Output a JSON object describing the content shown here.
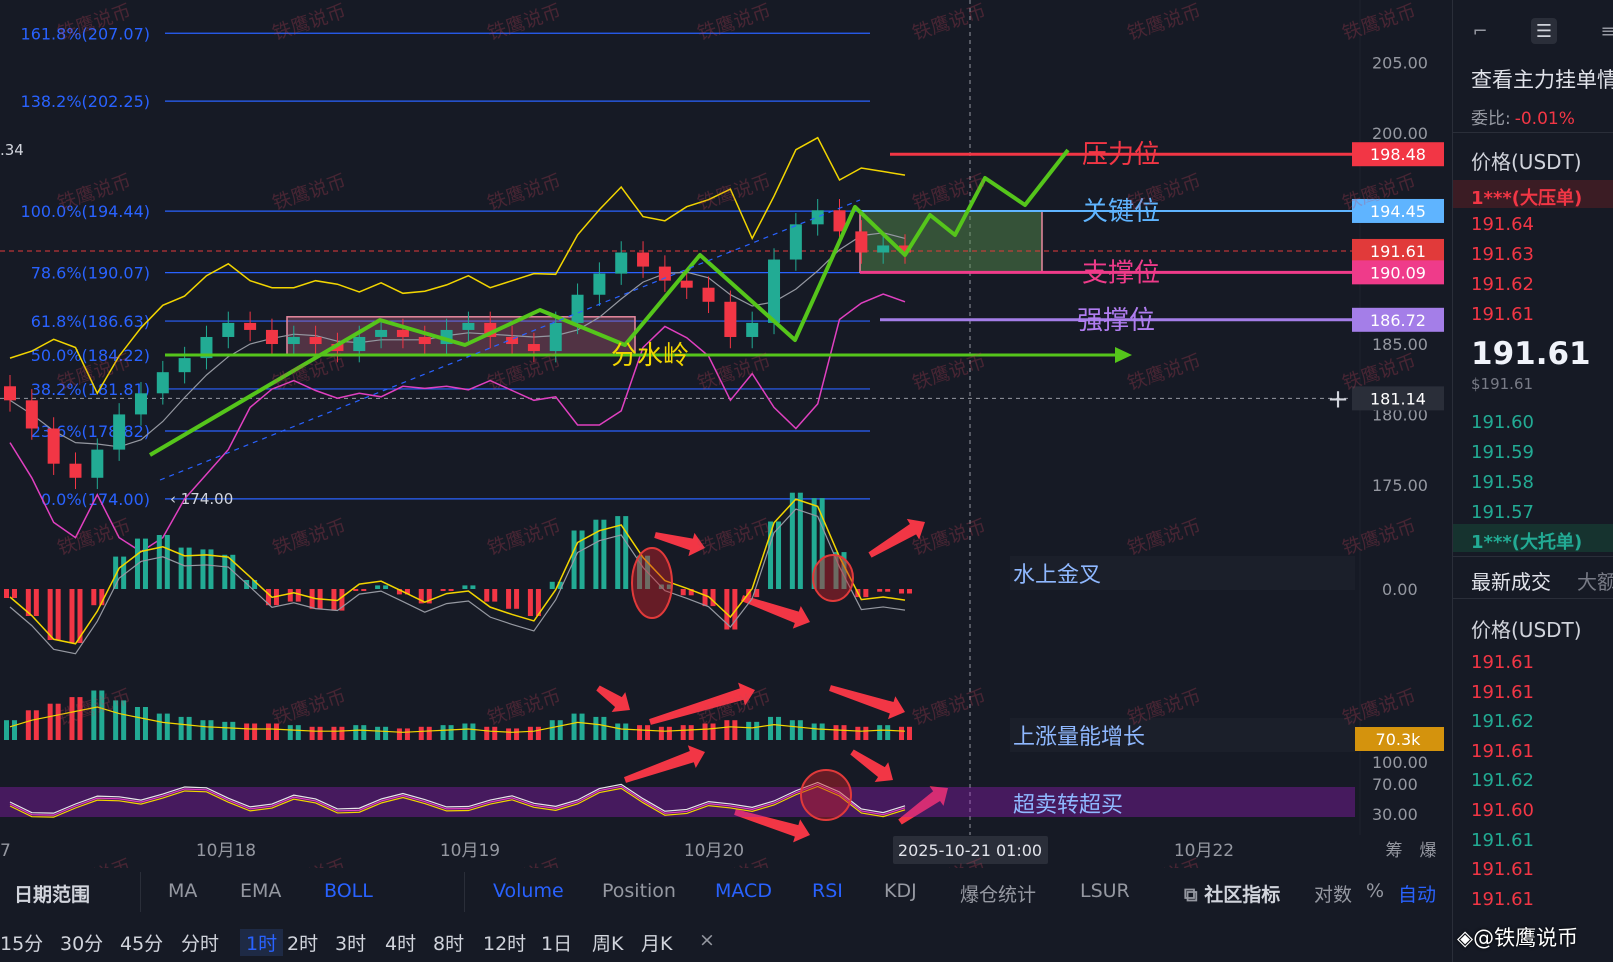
{
  "chart_data": {
    "type": "candlestick",
    "symbol_quote": "USDT",
    "y_ticks": [
      "205.00",
      "200.00",
      "185.00",
      "180.00",
      "175.00"
    ],
    "x_ticks": [
      "10月18",
      "10月19",
      "10月20",
      "10月22"
    ],
    "x_tick_partial_left": "7",
    "crosshair_time": "2025-10-21 01:00",
    "fib_levels": [
      {
        "label": "161.8%(207.07)",
        "value": 207.07
      },
      {
        "label": "138.2%(202.25)",
        "value": 202.25
      },
      {
        "label": "100.0%(194.44)",
        "value": 194.44
      },
      {
        "label": "78.6%(190.07)",
        "value": 190.07
      },
      {
        "label": "61.8%(186.63)",
        "value": 186.63
      },
      {
        "label": "50.0%(184.22)",
        "value": 184.22
      },
      {
        "label": "38.2%(181.81)",
        "value": 181.81
      },
      {
        "label": "23.6%(178.82)",
        "value": 178.82
      },
      {
        "label": "0.0%(174.00)",
        "value": 174.0
      }
    ],
    "low_marker": "174.00",
    "partial_left_label": ".34",
    "price_tags": [
      {
        "value": "198.48",
        "bg": "#f23645",
        "price": 198.48
      },
      {
        "value": "194.45",
        "bg": "#5fb4ff",
        "price": 194.45
      },
      {
        "value": "191.61",
        "bg": "#e13a3a",
        "price": 191.61
      },
      {
        "value": "190.09",
        "bg": "#ef3b8a",
        "price": 190.09
      },
      {
        "value": "186.72",
        "bg": "#a47ee8",
        "price": 186.72
      },
      {
        "value": "181.14",
        "bg": "#2a2e39",
        "price": 181.14
      }
    ],
    "annotations": [
      {
        "text": "压力位",
        "color": "#f23645",
        "price": 198.48
      },
      {
        "text": "关键位",
        "color": "#5fb4ff",
        "price": 194.45
      },
      {
        "text": "支撑位",
        "color": "#ef3b8a",
        "price": 190.09
      },
      {
        "text": "强撑位",
        "color": "#b07df0",
        "price": 186.72
      },
      {
        "text": "分水岭",
        "color": "#f2d500",
        "price": 184.22
      }
    ],
    "macd_zero_label": "0.00",
    "macd_annotation": "水上金叉",
    "volume_tag": "70.3k",
    "volume_annotation": "上涨量能增长",
    "rsi_ticks": [
      "100.00",
      "70.00",
      "30.00"
    ],
    "rsi_annotation": "超卖转超买",
    "watermark": "铁鹰说币",
    "candles_approx_close": [
      181,
      179,
      176.5,
      175.5,
      177.5,
      180,
      181.5,
      183,
      184,
      185.5,
      186.5,
      186,
      185,
      185.5,
      185,
      184.5,
      185.5,
      186,
      185.5,
      185,
      186,
      186.5,
      185.5,
      185,
      184.5,
      186.5,
      188.5,
      190,
      191.5,
      190.5,
      189.5,
      189,
      188,
      185.5,
      186.5,
      191,
      193.5,
      194.5,
      193,
      191.5,
      192,
      191.5
    ],
    "volume_approx": [
      60,
      90,
      110,
      130,
      150,
      120,
      100,
      80,
      70,
      60,
      55,
      50,
      50,
      45,
      40,
      40,
      45,
      40,
      35,
      40,
      45,
      50,
      40,
      35,
      40,
      60,
      80,
      70,
      50,
      45,
      40,
      45,
      50,
      60,
      55,
      70,
      60,
      50,
      45,
      40,
      45,
      40
    ]
  },
  "sidebar": {
    "title": "查看主力挂单情",
    "ratio_label": "委比:",
    "ratio_value": "-0.01%",
    "price_head": "价格(USDT)",
    "ask_big": "1***(大压单)",
    "asks": [
      "191.64",
      "191.63",
      "191.62",
      "191.61"
    ],
    "last_price": "191.61",
    "last_usd": "$191.61",
    "bids": [
      "191.60",
      "191.59",
      "191.58",
      "191.57"
    ],
    "bid_big": "1***(大托单)",
    "tab_trades": "最新成交",
    "tab_big": "大额",
    "trades_head": "价格(USDT)",
    "trades": [
      {
        "p": "191.61",
        "c": "red"
      },
      {
        "p": "191.61",
        "c": "red"
      },
      {
        "p": "191.62",
        "c": "green"
      },
      {
        "p": "191.61",
        "c": "red"
      },
      {
        "p": "191.62",
        "c": "green"
      },
      {
        "p": "191.60",
        "c": "red"
      },
      {
        "p": "191.61",
        "c": "green"
      },
      {
        "p": "191.61",
        "c": "red"
      },
      {
        "p": "191.61",
        "c": "red"
      }
    ],
    "brand": "@铁鹰说币"
  },
  "toolbar": {
    "date_range": "日期范围",
    "ma": "MA",
    "ema": "EMA",
    "boll": "BOLL",
    "volume": "Volume",
    "position": "Position",
    "macd": "MACD",
    "rsi": "RSI",
    "kdj": "KDJ",
    "liq": "爆仓统计",
    "lsur": "LSUR",
    "community": "社区指标",
    "log": "对数",
    "pct": "%",
    "auto": "自动",
    "intervals": [
      "15分",
      "30分",
      "45分",
      "分时",
      "1时",
      "2时",
      "3时",
      "4时",
      "8时",
      "12时",
      "1日",
      "周K",
      "月K"
    ],
    "close": "×",
    "right_top_a": "筹",
    "right_top_b": "爆"
  }
}
